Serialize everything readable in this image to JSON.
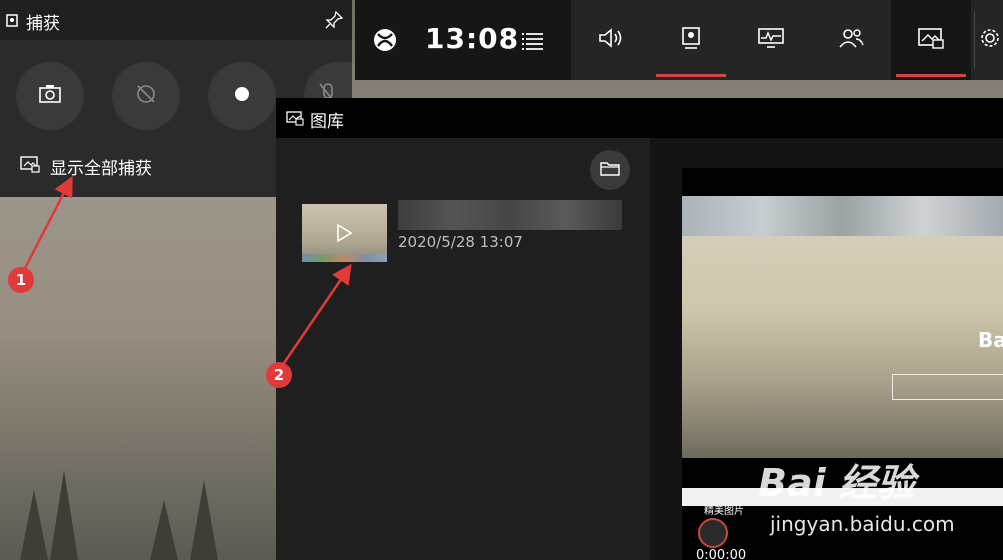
{
  "capture": {
    "title": "捕获",
    "show_all": "显示全部捕获"
  },
  "gamebar": {
    "time": "13:08"
  },
  "gallery": {
    "title": "图库",
    "clip": {
      "date": "2020/5/28 13:07"
    }
  },
  "preview": {
    "site_text": "Ba",
    "section_label": "精美图片",
    "timestamp": "0:00:00"
  },
  "annotations": {
    "marker1": "1",
    "marker2": "2",
    "watermark": "Bai 经验",
    "watermark_url": "jingyan.baidu.com"
  },
  "colors": {
    "accent": "#d9453a",
    "marker": "#e03a3a"
  }
}
